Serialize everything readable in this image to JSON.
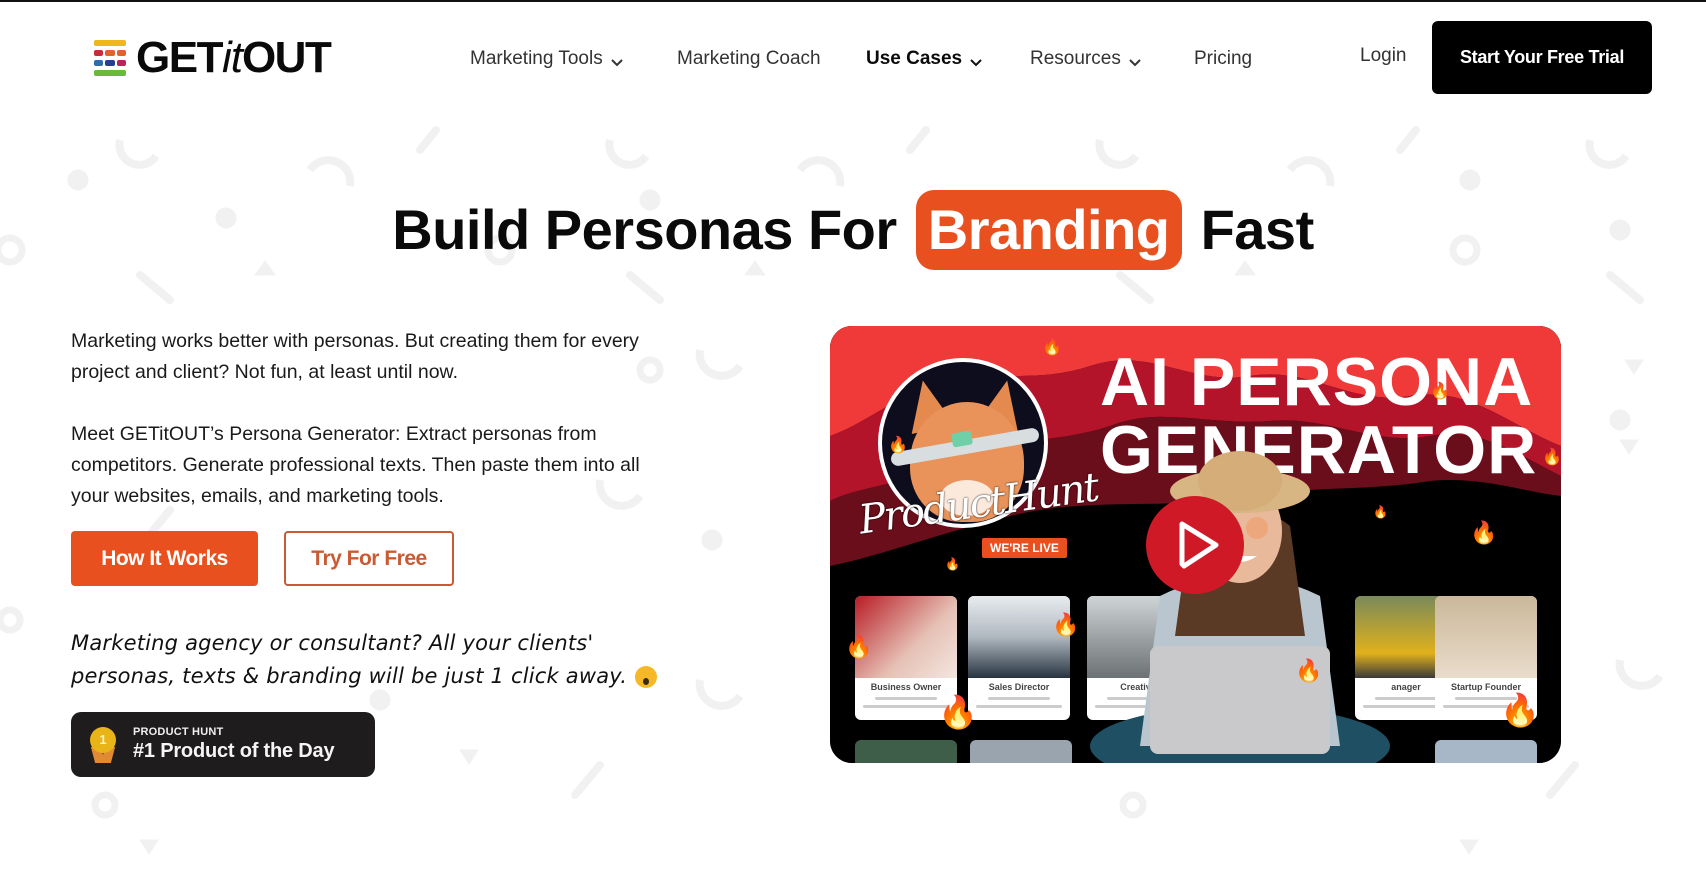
{
  "header": {
    "logo": {
      "text_a": "GET",
      "text_b": "it",
      "text_c": "OUT",
      "icon": "stacked-color-bars-logo-icon",
      "bar_colors": [
        "#e9b91e",
        "#c62d3a",
        "#e0612c",
        "#2b6ea8",
        "#273f8f",
        "#b8255a",
        "#6bb83a"
      ]
    },
    "nav": [
      {
        "label": "Marketing Tools",
        "has_dropdown": true,
        "active": false
      },
      {
        "label": "Marketing Coach",
        "has_dropdown": false,
        "active": false
      },
      {
        "label": "Use Cases",
        "has_dropdown": true,
        "active": true
      },
      {
        "label": "Resources",
        "has_dropdown": true,
        "active": false
      },
      {
        "label": "Pricing",
        "has_dropdown": false,
        "active": false
      }
    ],
    "login_label": "Login",
    "cta_label": "Start Your Free Trial"
  },
  "hero": {
    "title_before": "Build Personas For",
    "title_highlight": "Branding",
    "title_after": "Fast",
    "paragraph_1": "Marketing works better with personas. But creating them for every project and client? Not fun, at least until now.",
    "paragraph_2": "Meet GETitOUT’s Persona Generator: Extract personas from competitors. Generate professional texts. Then paste them into all your websites, emails, and marketing tools.",
    "primary_button": "How It Works",
    "secondary_button": "Try For Free",
    "handwritten_note": "Marketing agency or consultant? All your clients' personas, texts & branding will be just 1 click away.",
    "note_emoji": "exploding-head-emoji",
    "badge": {
      "kicker": "PRODUCT HUNT",
      "title": "#1 Product of the Day",
      "medal_number": "1",
      "icon": "gold-medal-icon"
    }
  },
  "video": {
    "title_line_1": "AI PERSONA",
    "title_line_2": "GENERATOR",
    "brand_script": "ProductHunt",
    "live_label": "WE'RE LIVE",
    "play_icon": "play-icon",
    "cards": [
      {
        "label": "Business Owner"
      },
      {
        "label": "Sales Director"
      },
      {
        "label": "Creative"
      },
      {
        "label": "anager"
      },
      {
        "label": "Startup Founder"
      }
    ]
  },
  "colors": {
    "accent": "#e8501f",
    "dark": "#000000",
    "badge_bg": "#1f1c1d",
    "video_red": "#f03a3a",
    "play_red": "#d01927"
  }
}
